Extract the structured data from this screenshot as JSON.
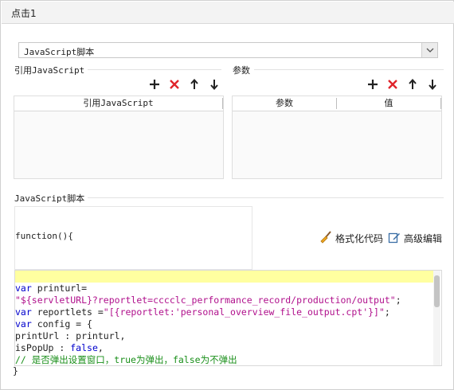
{
  "dialog": {
    "title": "点击1"
  },
  "script_type": {
    "selected": "JavaScript脚本"
  },
  "ref_js": {
    "label": "引用JavaScript",
    "column": "引用JavaScript"
  },
  "params": {
    "label": "参数",
    "columns": [
      "参数",
      "值"
    ]
  },
  "script_section": {
    "label": "JavaScript脚本"
  },
  "function_header": "function(){",
  "actions": {
    "format": "格式化代码",
    "advanced": "高级编辑"
  },
  "code": {
    "l1_kw": "var",
    "l1_rest": " printurl=",
    "l2_str": "\"${servletURL}?reportlet=cccclc_performance_record/production/output\"",
    "l2_rest": ";",
    "l3_kw": "var",
    "l3_rest": " reportlets =",
    "l3_str": "\"[{reportlet:'personal_overview_file_output.cpt'}]\"",
    "l3_end": ";",
    "l4_kw": "var",
    "l4_rest": " config = {",
    "l5": "printUrl : printurl,",
    "l6_a": "isPopUp : ",
    "l6_kw": "false",
    "l6_b": ",",
    "l7": "// 是否弹出设置窗口，true为弹出，false为不弹出"
  },
  "closing_brace": "}",
  "colors": {
    "delete": "#e0242b",
    "keyword": "#0000cc",
    "string": "#b0108c",
    "comment": "#1a8f1a",
    "highlight": "#ffffa0"
  },
  "icons": [
    "add-icon",
    "delete-icon",
    "move-up-icon",
    "move-down-icon",
    "broom-icon",
    "edit-icon",
    "chevron-down-icon"
  ]
}
